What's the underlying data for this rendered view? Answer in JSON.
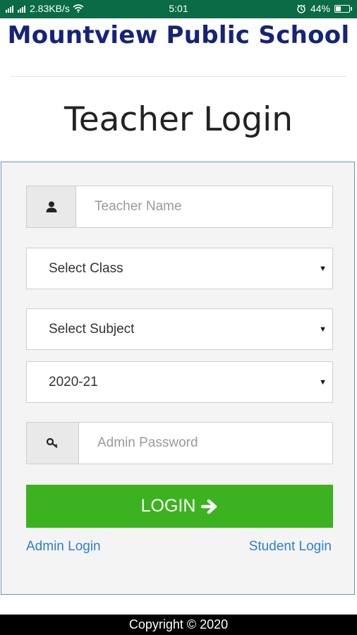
{
  "status_bar": {
    "network_speed": "2.83KB/s",
    "time": "5:01",
    "battery_percent": "44%",
    "battery_level": 0.44,
    "icons": [
      "signal-icon",
      "signal-icon",
      "wifi-icon",
      "alarm-icon",
      "battery-icon"
    ]
  },
  "header": {
    "school_name": "Mountview Public School",
    "page_title": "Teacher Login"
  },
  "form": {
    "teacher_name": {
      "placeholder": "Teacher Name",
      "value": "",
      "icon": "user-icon"
    },
    "class_select": {
      "selected": "Select Class"
    },
    "subject_select": {
      "selected": "Select Subject"
    },
    "session_select": {
      "selected": "2020-21"
    },
    "password": {
      "placeholder": "Admin Password",
      "value": "",
      "icon": "key-icon"
    },
    "login_label": "LOGIN",
    "login_icon": "arrow-right-icon"
  },
  "links": {
    "admin_login": "Admin Login",
    "student_login": "Student Login"
  },
  "footer": {
    "copyright": "Copyright © 2020"
  },
  "colors": {
    "status_bar": "#0a6b45",
    "school_name": "#16237a",
    "login_button": "#3db221",
    "link": "#2f7fcf",
    "panel_border": "#6e93bf"
  }
}
